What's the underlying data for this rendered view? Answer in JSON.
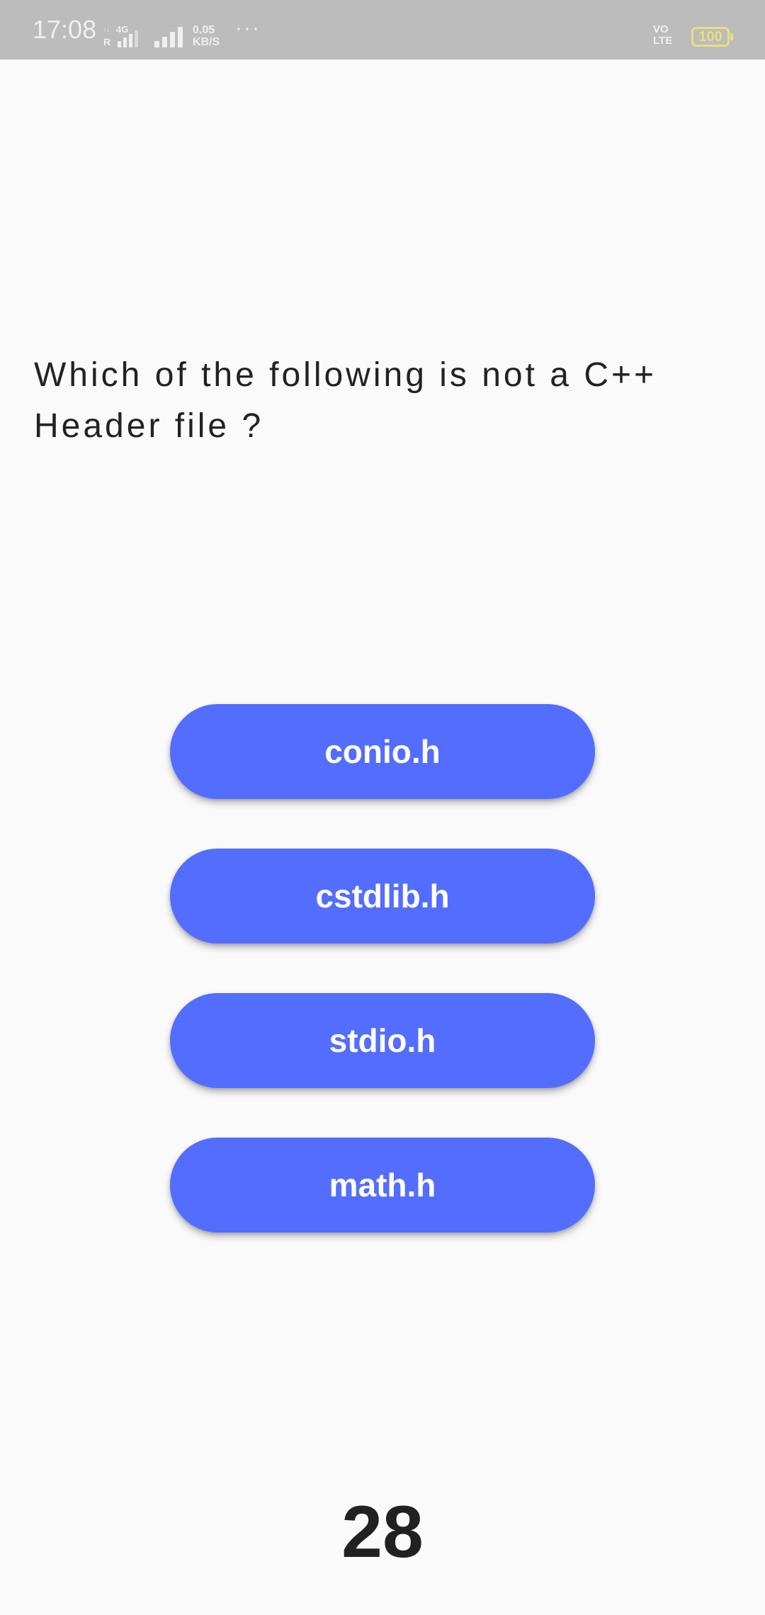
{
  "status_bar": {
    "time": "17:08",
    "network_type": "4G",
    "roaming": "R",
    "speed_value": "0.05",
    "speed_unit": "KB/S",
    "more": "···",
    "volte_top": "VO",
    "volte_bottom": "LTE",
    "battery": "100",
    "colors": {
      "background": "#bcbcbc",
      "text": "#efefef",
      "battery": "#e9df7e"
    }
  },
  "quiz": {
    "question": "Which of the following is not a C++ Header file ?",
    "options": [
      {
        "label": "conio.h"
      },
      {
        "label": "cstdlib.h"
      },
      {
        "label": "stdio.h"
      },
      {
        "label": "math.h"
      }
    ],
    "timer": "28"
  },
  "colors": {
    "page_background": "#fafafa",
    "button": "#536dfe",
    "button_text": "#ffffff",
    "question_text": "#222222"
  }
}
